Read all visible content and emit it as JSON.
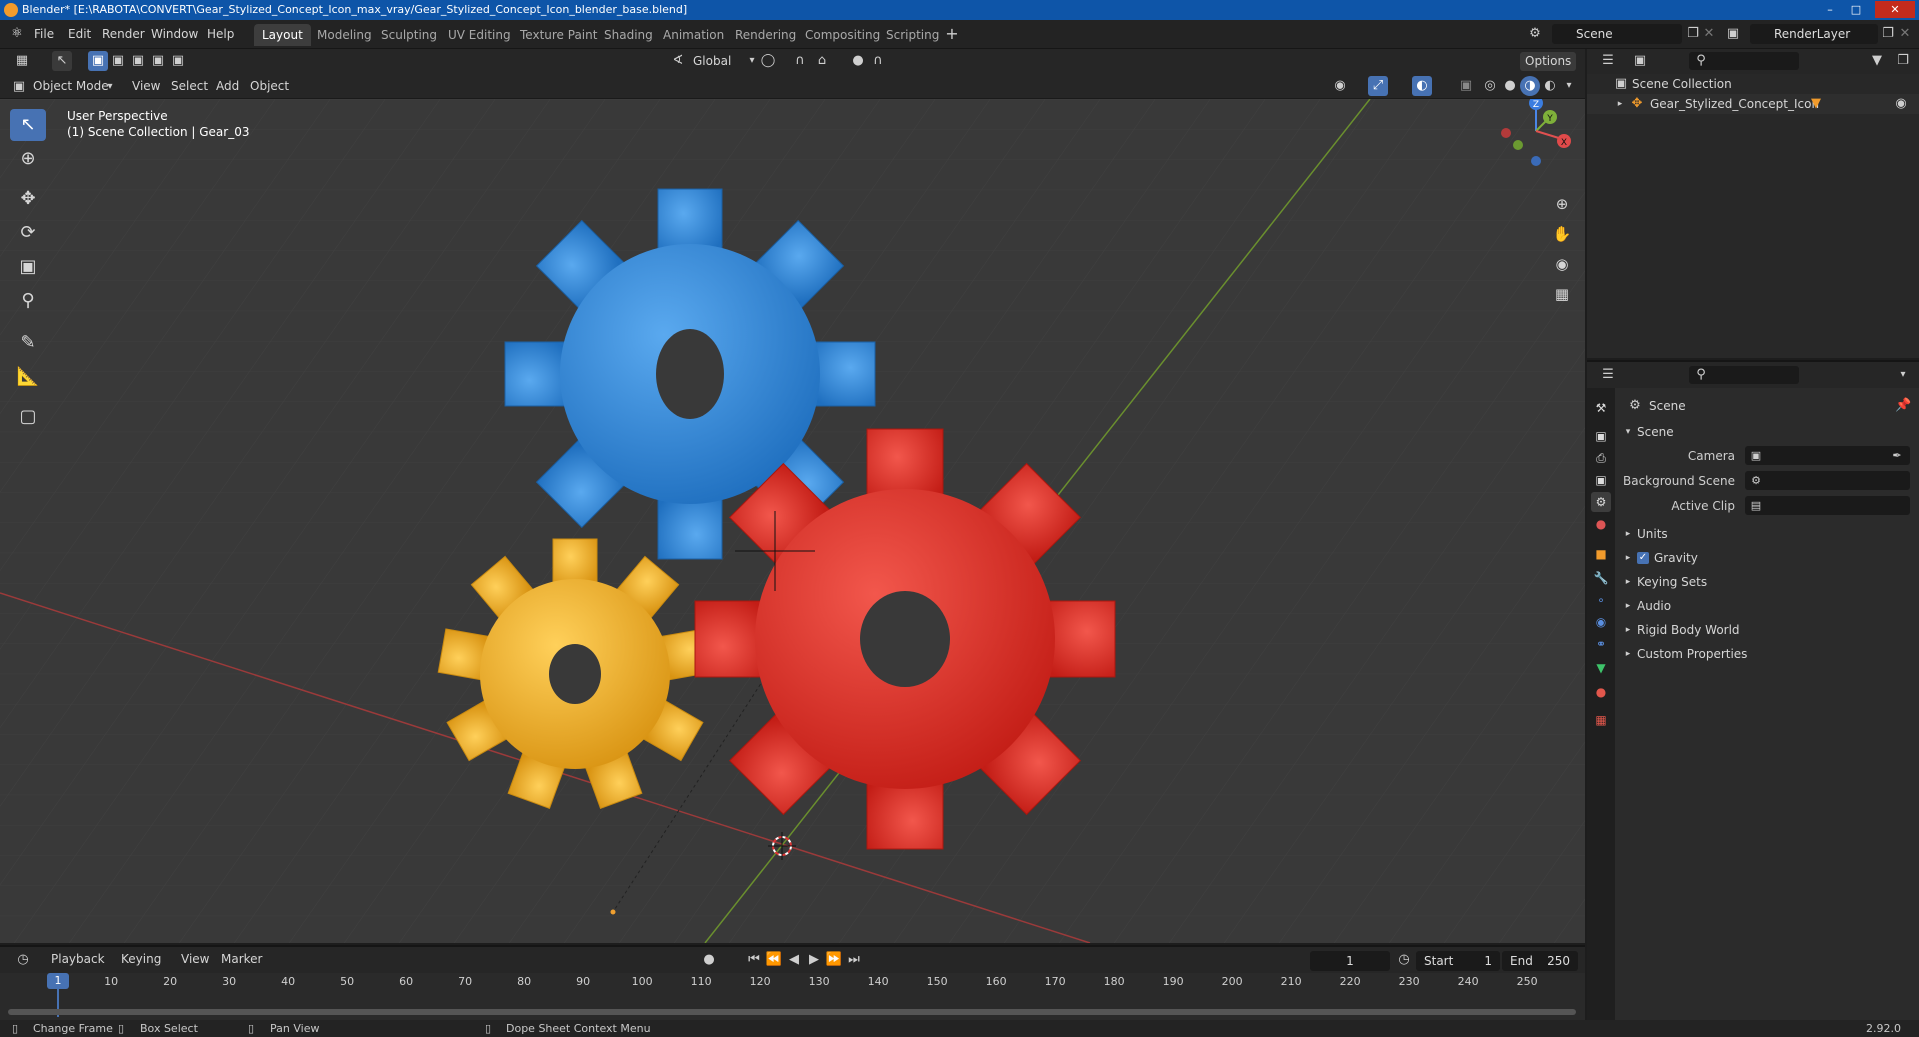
{
  "window": {
    "title": "Blender* [E:\\RABOTA\\CONVERT\\Gear_Stylized_Concept_Icon_max_vray/Gear_Stylized_Concept_Icon_blender_base.blend]",
    "version": "2.92.0"
  },
  "menu": [
    "File",
    "Edit",
    "Render",
    "Window",
    "Help"
  ],
  "workspaces": [
    {
      "label": "Layout",
      "active": true
    },
    {
      "label": "Modeling"
    },
    {
      "label": "Sculpting"
    },
    {
      "label": "UV Editing"
    },
    {
      "label": "Texture Paint"
    },
    {
      "label": "Shading"
    },
    {
      "label": "Animation"
    },
    {
      "label": "Rendering"
    },
    {
      "label": "Compositing"
    },
    {
      "label": "Scripting"
    }
  ],
  "scene_field": "Scene",
  "renderlayer_field": "RenderLayer",
  "viewport_header": {
    "transform_orientation": "Global",
    "options_label": "Options",
    "mode": "Object Mode",
    "menus": [
      "View",
      "Select",
      "Add",
      "Object"
    ]
  },
  "viewport": {
    "perspective_label": "User Perspective",
    "collection_label": "(1) Scene Collection | Gear_03",
    "gizmo_axes": [
      "Z",
      "Y",
      "X"
    ]
  },
  "outliner": {
    "root": "Scene Collection",
    "items": [
      "Gear_Stylized_Concept_Icon"
    ]
  },
  "properties": {
    "context": "Scene",
    "panel": "Scene",
    "fields": [
      {
        "label": "Camera"
      },
      {
        "label": "Background Scene"
      },
      {
        "label": "Active Clip"
      }
    ],
    "sections": [
      {
        "label": "Units"
      },
      {
        "label": "Gravity",
        "checked": true
      },
      {
        "label": "Keying Sets"
      },
      {
        "label": "Audio"
      },
      {
        "label": "Rigid Body World"
      },
      {
        "label": "Custom Properties"
      }
    ]
  },
  "timeline": {
    "menus": [
      "Playback",
      "Keying",
      "View",
      "Marker"
    ],
    "current_frame": "1",
    "start_label": "Start",
    "start": "1",
    "end_label": "End",
    "end": "250",
    "ticks": [
      "1",
      "10",
      "20",
      "30",
      "40",
      "50",
      "60",
      "70",
      "80",
      "90",
      "100",
      "110",
      "120",
      "130",
      "140",
      "150",
      "160",
      "170",
      "180",
      "190",
      "200",
      "210",
      "220",
      "230",
      "240",
      "250"
    ]
  },
  "statusbar": {
    "items": [
      "Change Frame",
      "Box Select",
      "Pan View",
      "Dope Sheet Context Menu"
    ]
  },
  "colors": {
    "accent": "#4772b3",
    "gear_blue": "#2f8de0",
    "gear_red": "#e2342a",
    "gear_yellow": "#f0b429",
    "viewport_bg": "#393939"
  }
}
